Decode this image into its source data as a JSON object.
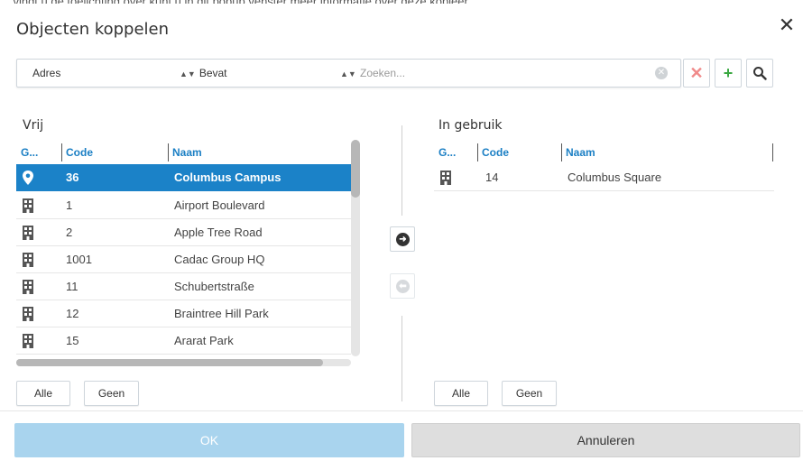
{
  "top_strip": "... vindt u de toelichting over kunt u in dit popup venster meer informatie over deze kopieer...",
  "dialog": {
    "title": "Objecten koppelen",
    "close_icon": "close-icon"
  },
  "filter": {
    "field": "Adres",
    "operator": "Bevat",
    "search_placeholder": "Zoeken...",
    "clear_icon": "clear-icon",
    "buttons": [
      "remove-filter-icon",
      "add-filter-icon",
      "search-icon"
    ]
  },
  "left": {
    "title": "Vrij",
    "headers": [
      "G...",
      "Code",
      "Naam"
    ],
    "rows": [
      {
        "icon": "location-pin-icon",
        "code": "36",
        "name": "Columbus Campus",
        "selected": true
      },
      {
        "icon": "building-icon",
        "code": "1",
        "name": "Airport Boulevard"
      },
      {
        "icon": "building-icon",
        "code": "2",
        "name": "Apple Tree Road"
      },
      {
        "icon": "building-icon",
        "code": "1001",
        "name": "Cadac Group HQ"
      },
      {
        "icon": "building-icon",
        "code": "11",
        "name": "Schubertstraße"
      },
      {
        "icon": "building-icon",
        "code": "12",
        "name": "Braintree Hill Park"
      },
      {
        "icon": "building-icon",
        "code": "15",
        "name": "Ararat Park"
      }
    ],
    "all_label": "Alle",
    "none_label": "Geen"
  },
  "right": {
    "title": "In gebruik",
    "headers": [
      "G...",
      "Code",
      "Naam"
    ],
    "rows": [
      {
        "icon": "building-icon",
        "code": "14",
        "name": "Columbus Square"
      }
    ],
    "all_label": "Alle",
    "none_label": "Geen"
  },
  "move": {
    "right_icon": "arrow-right-icon",
    "left_icon": "arrow-left-icon"
  },
  "footer": {
    "ok_label": "OK",
    "cancel_label": "Annuleren"
  },
  "colors": {
    "accent": "#1b82c8",
    "ok_bg": "#a9d4ee",
    "header_text": "#1b7fc4"
  }
}
